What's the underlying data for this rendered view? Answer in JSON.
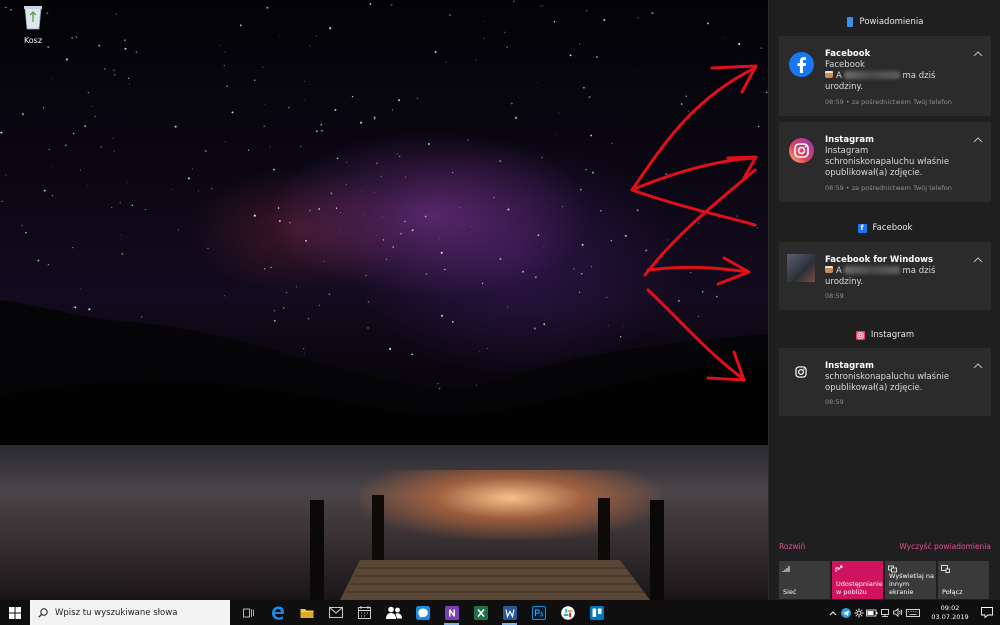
{
  "desktop": {
    "recycle_bin_label": "Kosz"
  },
  "action_center": {
    "title": "Powiadomienia",
    "groups": [
      {
        "header": "",
        "cards": [
          {
            "title": "Facebook",
            "line1": "Facebook",
            "line2_suffix": "ma dziś",
            "line3": "urodziny.",
            "meta": "08:59 • za pośrednictwem Twój telefon",
            "icon": "facebook-icon"
          },
          {
            "title": "Instagram",
            "line1": "Instagram",
            "line2": "schroniskonapaluchu właśnie",
            "line3": "opublikował(a) zdjęcie.",
            "meta": "08:59 • za pośrednictwem Twój telefon",
            "icon": "instagram-icon"
          }
        ]
      },
      {
        "header": "Facebook",
        "cards": [
          {
            "title": "Facebook for Windows",
            "line1_suffix": "ma dziś",
            "line2": "urodziny.",
            "meta": "08:59",
            "icon": "profile-photo"
          }
        ]
      },
      {
        "header": "Instagram",
        "cards": [
          {
            "title": "Instagram",
            "line1": "schroniskonapaluchu właśnie",
            "line2": "opublikował(a) zdjęcie.",
            "meta": "08:59",
            "icon": "instagram-outline-icon"
          }
        ]
      }
    ],
    "expand_label": "Rozwiń",
    "clear_label": "Wyczyść powiadomienia",
    "quick_actions": [
      {
        "label": "Sieć",
        "active": false,
        "icon": "network-icon"
      },
      {
        "label": "Udostępnianie w pobliżu",
        "active": true,
        "icon": "share-icon"
      },
      {
        "label": "Wyświetlaj na innym ekranie",
        "active": false,
        "icon": "project-icon"
      },
      {
        "label": "Połącz",
        "active": false,
        "icon": "connect-icon"
      }
    ],
    "accent_color": "#d0135f"
  },
  "taskbar": {
    "search_placeholder": "Wpisz tu wyszukiwane słowa",
    "apps": [
      "task-view-icon",
      "edge-icon",
      "file-explorer-icon",
      "mail-icon",
      "calendar-icon",
      "people-icon",
      "messenger-icon",
      "onenote-icon",
      "excel-icon",
      "word-icon",
      "photoshop-icon",
      "slack-icon",
      "trello-icon"
    ],
    "time": "09:02",
    "date": "03.07.2019"
  }
}
